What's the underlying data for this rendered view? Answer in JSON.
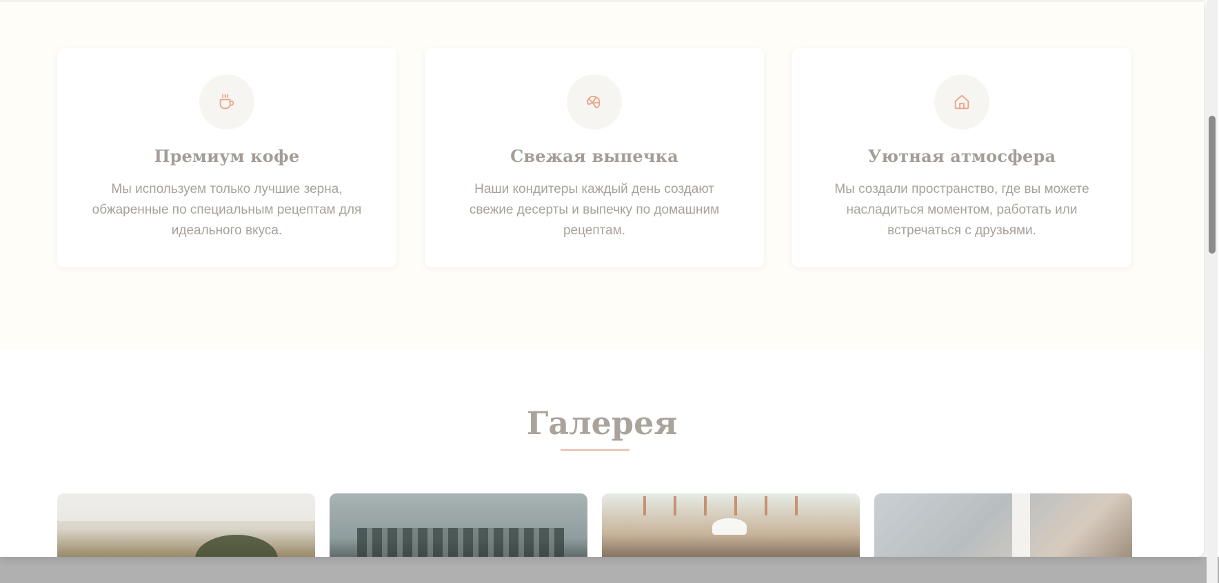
{
  "features": [
    {
      "icon": "coffee-cup-icon",
      "title": "Премиум кофе",
      "text": "Мы используем только лучшие зерна, обжаренные по специальным рецептам для идеального вкуса."
    },
    {
      "icon": "croissant-icon",
      "title": "Свежая выпечка",
      "text": "Наши кондитеры каждый день создают свежие десерты и выпечку по домашним рецептам."
    },
    {
      "icon": "home-icon",
      "title": "Уютная атмосфера",
      "text": "Мы создали пространство, где вы можете насладиться моментом, работать или встречаться с друзьями."
    }
  ],
  "gallery": {
    "title": "Галерея",
    "photos": [
      "cafe-interior",
      "bar-counter",
      "plant-terrace",
      "latte-pour"
    ]
  },
  "colors": {
    "accent": "#e8a588",
    "section_bg": "#fffdf8",
    "text": "#a8a19b"
  }
}
